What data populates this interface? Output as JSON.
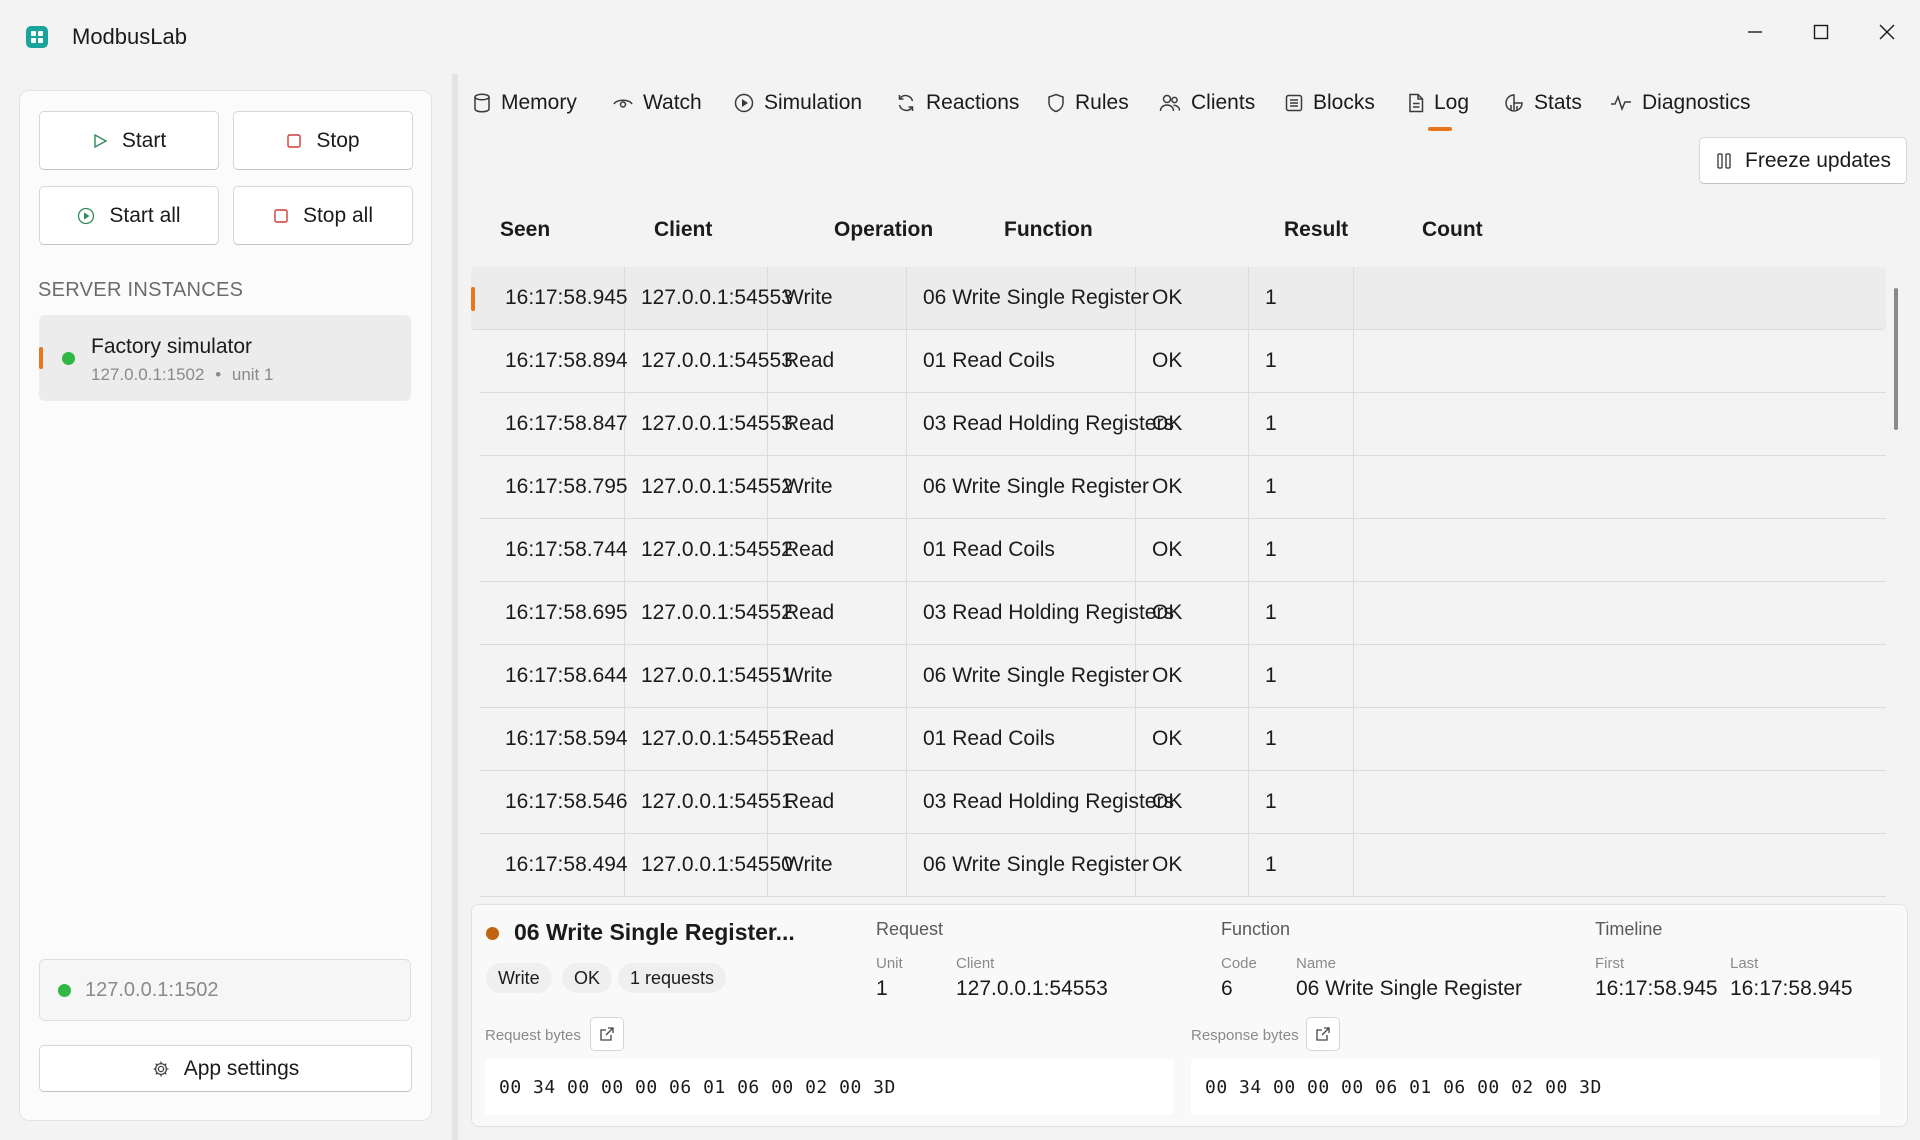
{
  "app": {
    "title": "ModbusLab"
  },
  "sidebar": {
    "buttons": {
      "start": "Start",
      "stop": "Stop",
      "start_all": "Start all",
      "stop_all": "Stop all"
    },
    "section_label": "SERVER INSTANCES",
    "instances": [
      {
        "name": "Factory simulator",
        "address": "127.0.0.1:1502",
        "unit": "unit 1",
        "separator": "•",
        "status_color": "#2fb844"
      }
    ],
    "status_endpoint": "127.0.0.1:1502",
    "settings_label": "App settings"
  },
  "tabs": [
    {
      "label": "Memory",
      "icon": "database-icon"
    },
    {
      "label": "Watch",
      "icon": "eye-icon"
    },
    {
      "label": "Simulation",
      "icon": "play-circle-icon"
    },
    {
      "label": "Reactions",
      "icon": "refresh-icon"
    },
    {
      "label": "Rules",
      "icon": "shield-icon"
    },
    {
      "label": "Clients",
      "icon": "users-icon"
    },
    {
      "label": "Blocks",
      "icon": "blocks-icon"
    },
    {
      "label": "Log",
      "icon": "document-icon",
      "active": true
    },
    {
      "label": "Stats",
      "icon": "stats-icon"
    },
    {
      "label": "Diagnostics",
      "icon": "pulse-icon"
    }
  ],
  "toolbar": {
    "freeze_label": "Freeze updates"
  },
  "log": {
    "columns": [
      "Seen",
      "Client",
      "Operation",
      "Function",
      "Result",
      "Count"
    ],
    "rows": [
      [
        "16:17:58.945",
        "127.0.0.1:54553",
        "Write",
        "06 Write Single Register",
        "OK",
        "1"
      ],
      [
        "16:17:58.894",
        "127.0.0.1:54553",
        "Read",
        "01 Read Coils",
        "OK",
        "1"
      ],
      [
        "16:17:58.847",
        "127.0.0.1:54553",
        "Read",
        "03 Read Holding Registers",
        "OK",
        "1"
      ],
      [
        "16:17:58.795",
        "127.0.0.1:54552",
        "Write",
        "06 Write Single Register",
        "OK",
        "1"
      ],
      [
        "16:17:58.744",
        "127.0.0.1:54552",
        "Read",
        "01 Read Coils",
        "OK",
        "1"
      ],
      [
        "16:17:58.695",
        "127.0.0.1:54552",
        "Read",
        "03 Read Holding Registers",
        "OK",
        "1"
      ],
      [
        "16:17:58.644",
        "127.0.0.1:54551",
        "Write",
        "06 Write Single Register",
        "OK",
        "1"
      ],
      [
        "16:17:58.594",
        "127.0.0.1:54551",
        "Read",
        "01 Read Coils",
        "OK",
        "1"
      ],
      [
        "16:17:58.546",
        "127.0.0.1:54551",
        "Read",
        "03 Read Holding Registers",
        "OK",
        "1"
      ],
      [
        "16:17:58.494",
        "127.0.0.1:54550",
        "Write",
        "06 Write Single Register",
        "OK",
        "1"
      ]
    ]
  },
  "details": {
    "title": "06 Write Single Register...",
    "chips": [
      "Write",
      "OK",
      "1 requests"
    ],
    "request": {
      "label": "Request",
      "unit_label": "Unit",
      "unit": "1",
      "client_label": "Client",
      "client": "127.0.0.1:54553"
    },
    "function": {
      "label": "Function",
      "code_label": "Code",
      "code": "6",
      "name_label": "Name",
      "name": "06 Write Single Register"
    },
    "timeline": {
      "label": "Timeline",
      "first_label": "First",
      "first": "16:17:58.945",
      "last_label": "Last",
      "last": "16:17:58.945"
    },
    "request_bytes_label": "Request bytes",
    "request_bytes": "00 34 00 00 00 06 01 06 00 02 00 3D",
    "response_bytes_label": "Response bytes",
    "response_bytes": "00 34 00 00 00 06 01 06 00 02 00 3D"
  },
  "colors": {
    "accent": "#e8771b",
    "ok_green": "#2fb844",
    "brand": "#1aa39a",
    "detail_dot": "#c0640f"
  }
}
